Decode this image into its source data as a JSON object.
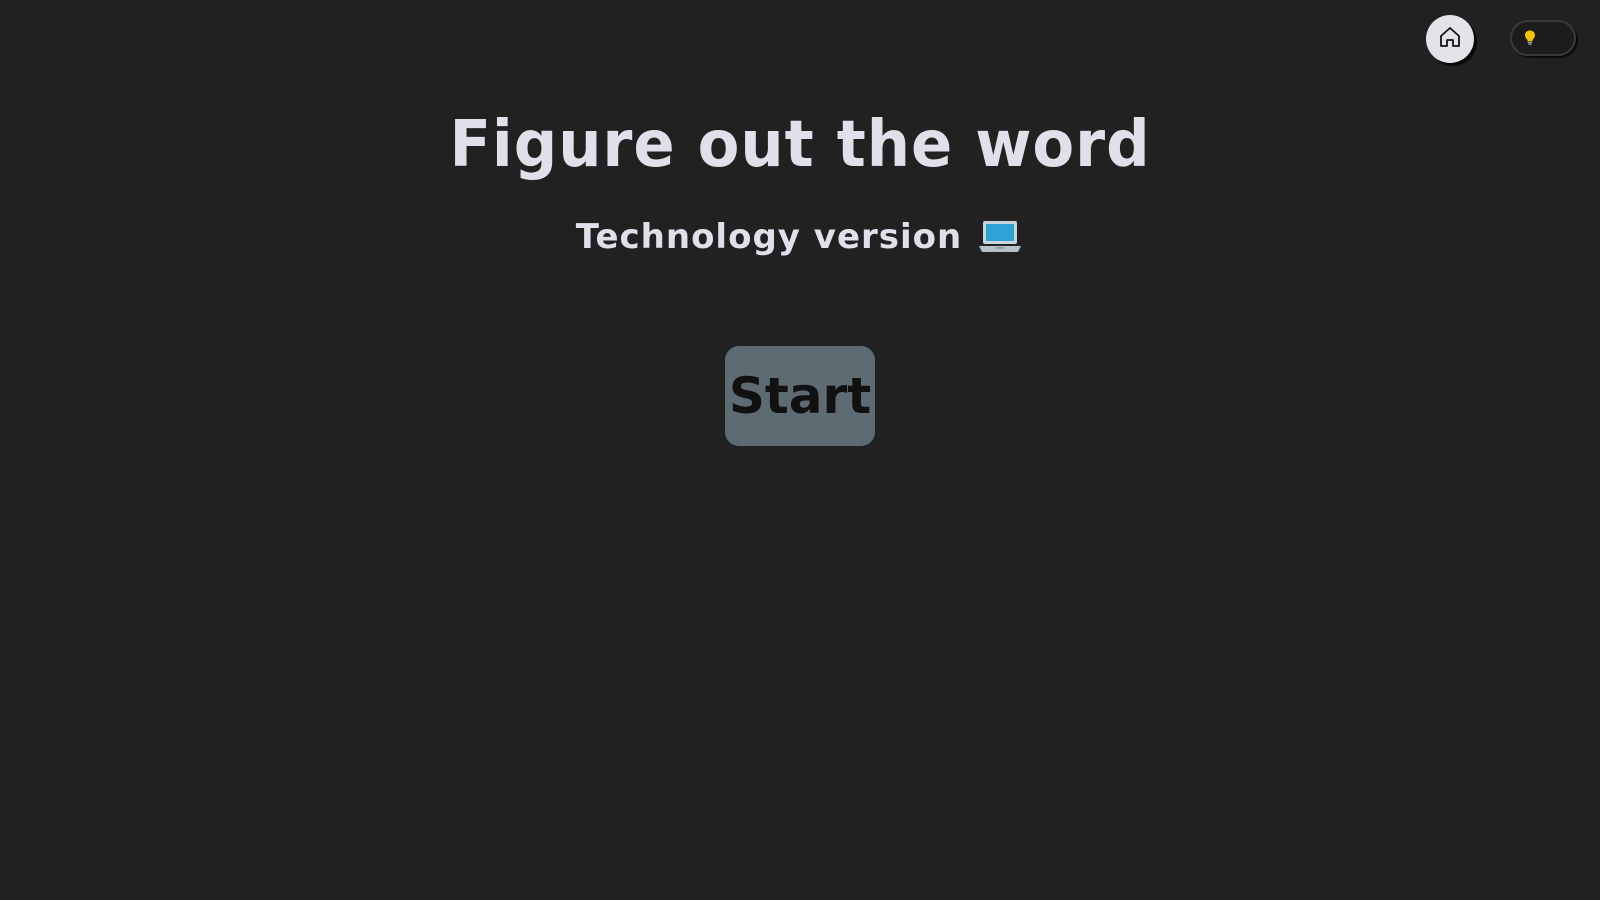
{
  "header": {
    "home_button": {
      "icon": "home-icon"
    },
    "theme_toggle": {
      "icon": "lightbulb-icon",
      "state": "dark"
    }
  },
  "main": {
    "title": "Figure out the word",
    "subtitle": "Technology version",
    "subtitle_icon": "laptop-icon",
    "start_label": "Start"
  },
  "colors": {
    "background": "#212121",
    "text": "#e0e0ea",
    "start_button": "#5f6b73",
    "home_button": "#e3e3ea",
    "bulb": "#f5c400"
  }
}
